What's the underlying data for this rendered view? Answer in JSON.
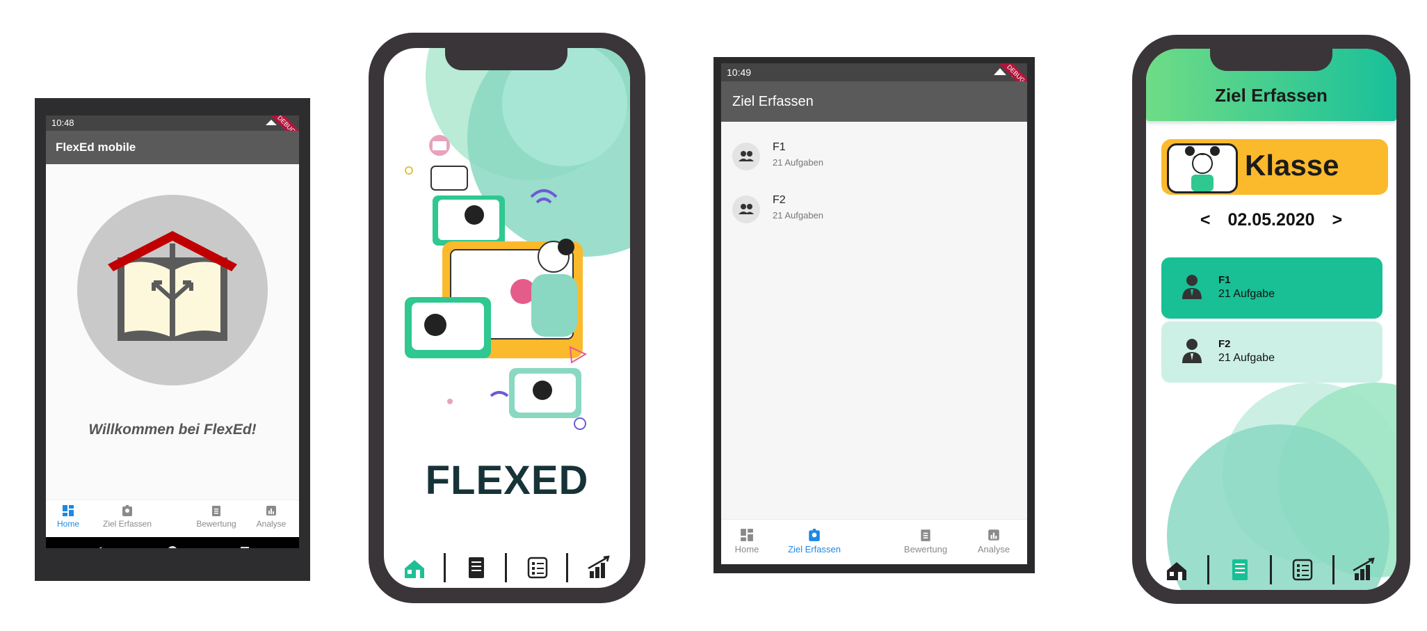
{
  "screen1": {
    "status_time": "10:48",
    "debug_label": "DEBUG",
    "app_title": "FlexEd mobile",
    "welcome_text": "Willkommen bei FlexEd!",
    "nav": [
      {
        "label": "Home",
        "icon": "dashboard-icon",
        "active": true
      },
      {
        "label": "Ziel Erfassen",
        "icon": "badge-icon",
        "active": false
      },
      {
        "label": "Bewertung",
        "icon": "clipboard-icon",
        "active": false
      },
      {
        "label": "Analyse",
        "icon": "chart-icon",
        "active": false
      }
    ],
    "colors": {
      "active": "#1e88e5",
      "inactive": "#8a8a8a",
      "roof": "#c00000"
    }
  },
  "screen2": {
    "brand": "FLEXED",
    "nav_icons": [
      "home-icon",
      "document-icon",
      "checklist-icon",
      "growth-chart-icon"
    ],
    "colors": {
      "brand_text": "#173338",
      "accent": "#1fbf94",
      "frame": "#3a3538"
    }
  },
  "screen3": {
    "status_time": "10:49",
    "debug_label": "DEBUG",
    "app_title": "Ziel Erfassen",
    "items": [
      {
        "title": "F1",
        "subtitle": "21 Aufgaben"
      },
      {
        "title": "F2",
        "subtitle": "21 Aufgaben"
      }
    ],
    "nav": [
      {
        "label": "Home",
        "icon": "dashboard-icon",
        "active": false
      },
      {
        "label": "Ziel Erfassen",
        "icon": "badge-icon",
        "active": true
      },
      {
        "label": "Bewertung",
        "icon": "clipboard-icon",
        "active": false
      },
      {
        "label": "Analyse",
        "icon": "chart-icon",
        "active": false
      }
    ]
  },
  "screen4": {
    "header_title": "Ziel Erfassen",
    "klasse_label": "Klasse",
    "date_prev": "<",
    "date": "02.05.2020",
    "date_next": ">",
    "items": [
      {
        "title": "F1",
        "subtitle": "21 Aufgabe",
        "bg": "#19bf95"
      },
      {
        "title": "F2",
        "subtitle": "21 Aufgabe",
        "bg": "#cdf0e6"
      }
    ],
    "nav_icons": [
      "home-icon",
      "document-icon",
      "checklist-icon",
      "growth-chart-icon"
    ],
    "colors": {
      "klasse_bg": "#fbb92c",
      "active_icon": "#19bf95"
    }
  }
}
